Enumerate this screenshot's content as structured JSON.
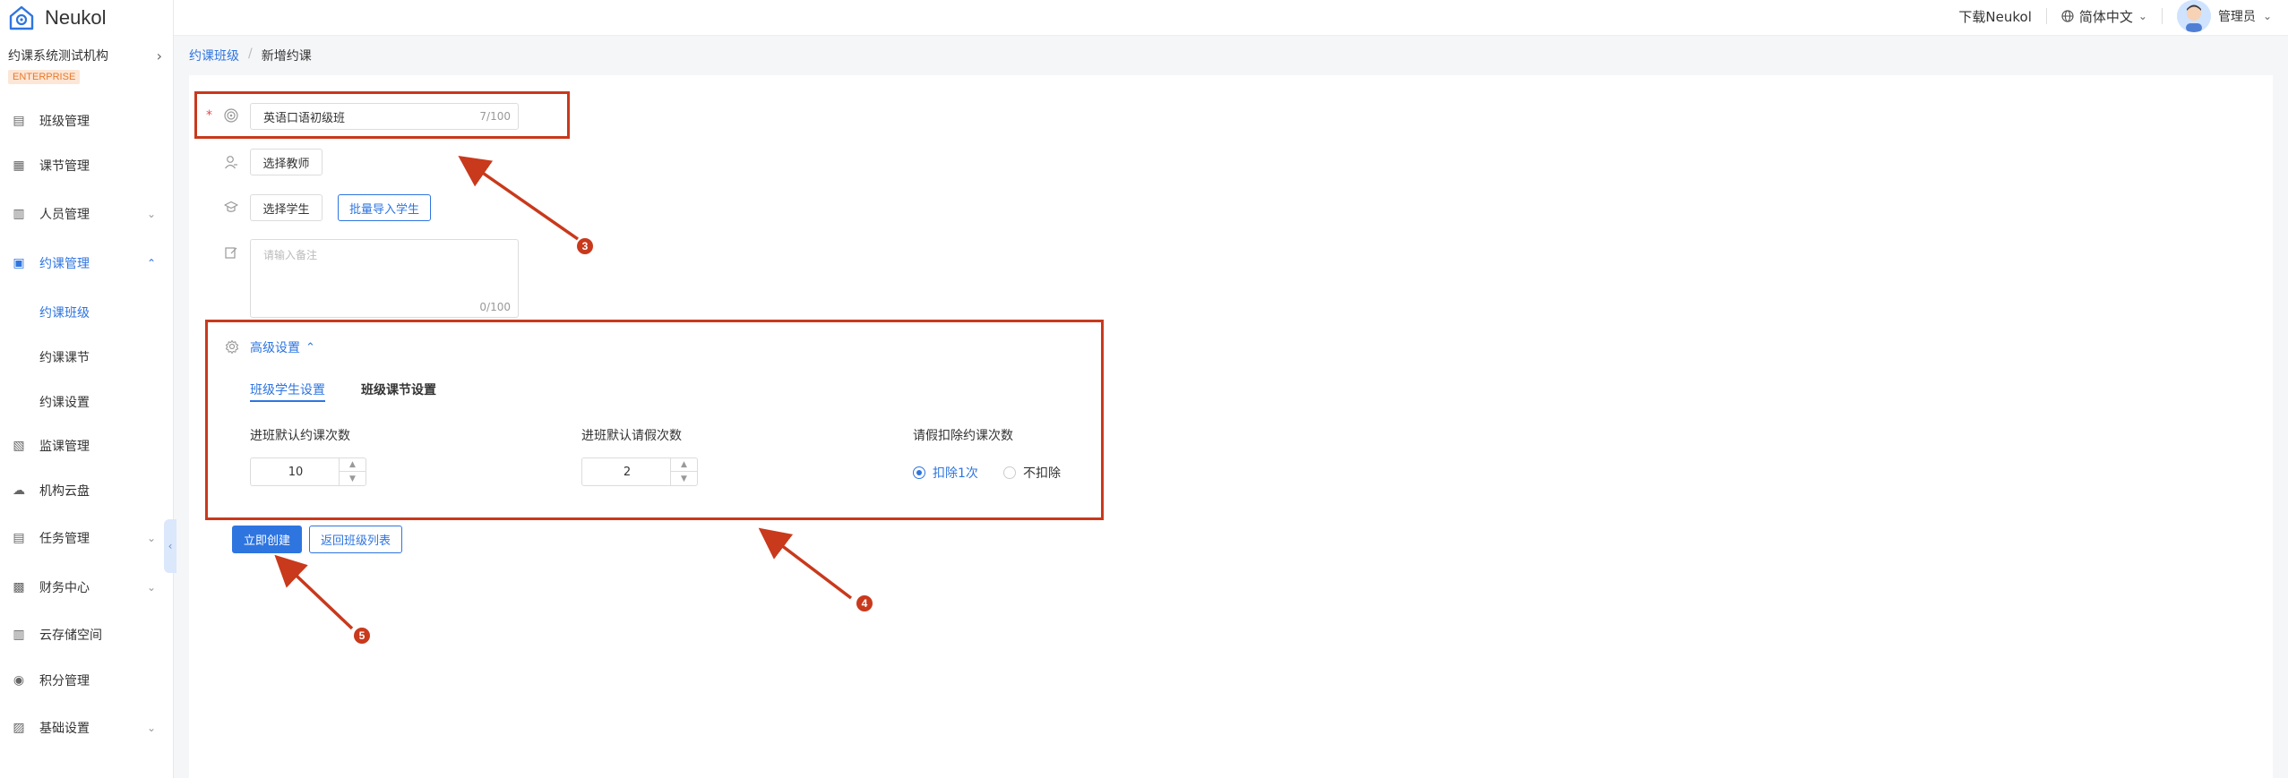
{
  "app": {
    "name": "Neukol"
  },
  "sidebar": {
    "org_name": "约课系统测试机构",
    "org_badge": "ENTERPRISE",
    "items": [
      {
        "label": "班级管理",
        "icon": "class-icon"
      },
      {
        "label": "课节管理",
        "icon": "lesson-icon"
      },
      {
        "label": "人员管理",
        "icon": "people-icon",
        "expandable": true
      },
      {
        "label": "约课管理",
        "icon": "booking-icon",
        "expandable": true,
        "expanded": true,
        "active": true
      },
      {
        "label": "监课管理",
        "icon": "monitor-icon"
      },
      {
        "label": "机构云盘",
        "icon": "cloud-icon"
      },
      {
        "label": "任务管理",
        "icon": "task-icon",
        "expandable": true
      },
      {
        "label": "财务中心",
        "icon": "finance-icon",
        "expandable": true
      },
      {
        "label": "云存储空间",
        "icon": "storage-icon"
      },
      {
        "label": "积分管理",
        "icon": "points-icon"
      },
      {
        "label": "基础设置",
        "icon": "settings-icon",
        "expandable": true
      }
    ],
    "sub_items": [
      {
        "label": "约课班级",
        "active": true
      },
      {
        "label": "约课课节"
      },
      {
        "label": "约课设置"
      }
    ]
  },
  "header": {
    "download": "下载Neukol",
    "language": "简体中文",
    "user": "管理员"
  },
  "breadcrumb": {
    "parent": "约课班级",
    "separator": "/",
    "current": "新增约课"
  },
  "form": {
    "class_name": {
      "value": "英语口语初级班",
      "counter": "7/100"
    },
    "select_teacher": "选择教师",
    "select_student": "选择学生",
    "batch_import": "批量导入学生",
    "remark": {
      "placeholder": "请输入备注",
      "counter": "0/100"
    },
    "advanced": {
      "title": "高级设置",
      "tabs": [
        "班级学生设置",
        "班级课节设置"
      ],
      "fields": {
        "default_booking_label": "进班默认约课次数",
        "default_booking_value": "10",
        "default_leave_label": "进班默认请假次数",
        "default_leave_value": "2",
        "leave_deduct_label": "请假扣除约课次数",
        "deduct_options": [
          "扣除1次",
          "不扣除"
        ],
        "deduct_selected": "扣除1次"
      }
    },
    "create_button": "立即创建",
    "back_button": "返回班级列表"
  },
  "annotations": {
    "labels": [
      "3",
      "4",
      "5"
    ],
    "color": "#c9391c"
  },
  "colors": {
    "accent": "#2e75e0",
    "annotation": "#c9391c",
    "badge_bg": "#fde6d5"
  }
}
